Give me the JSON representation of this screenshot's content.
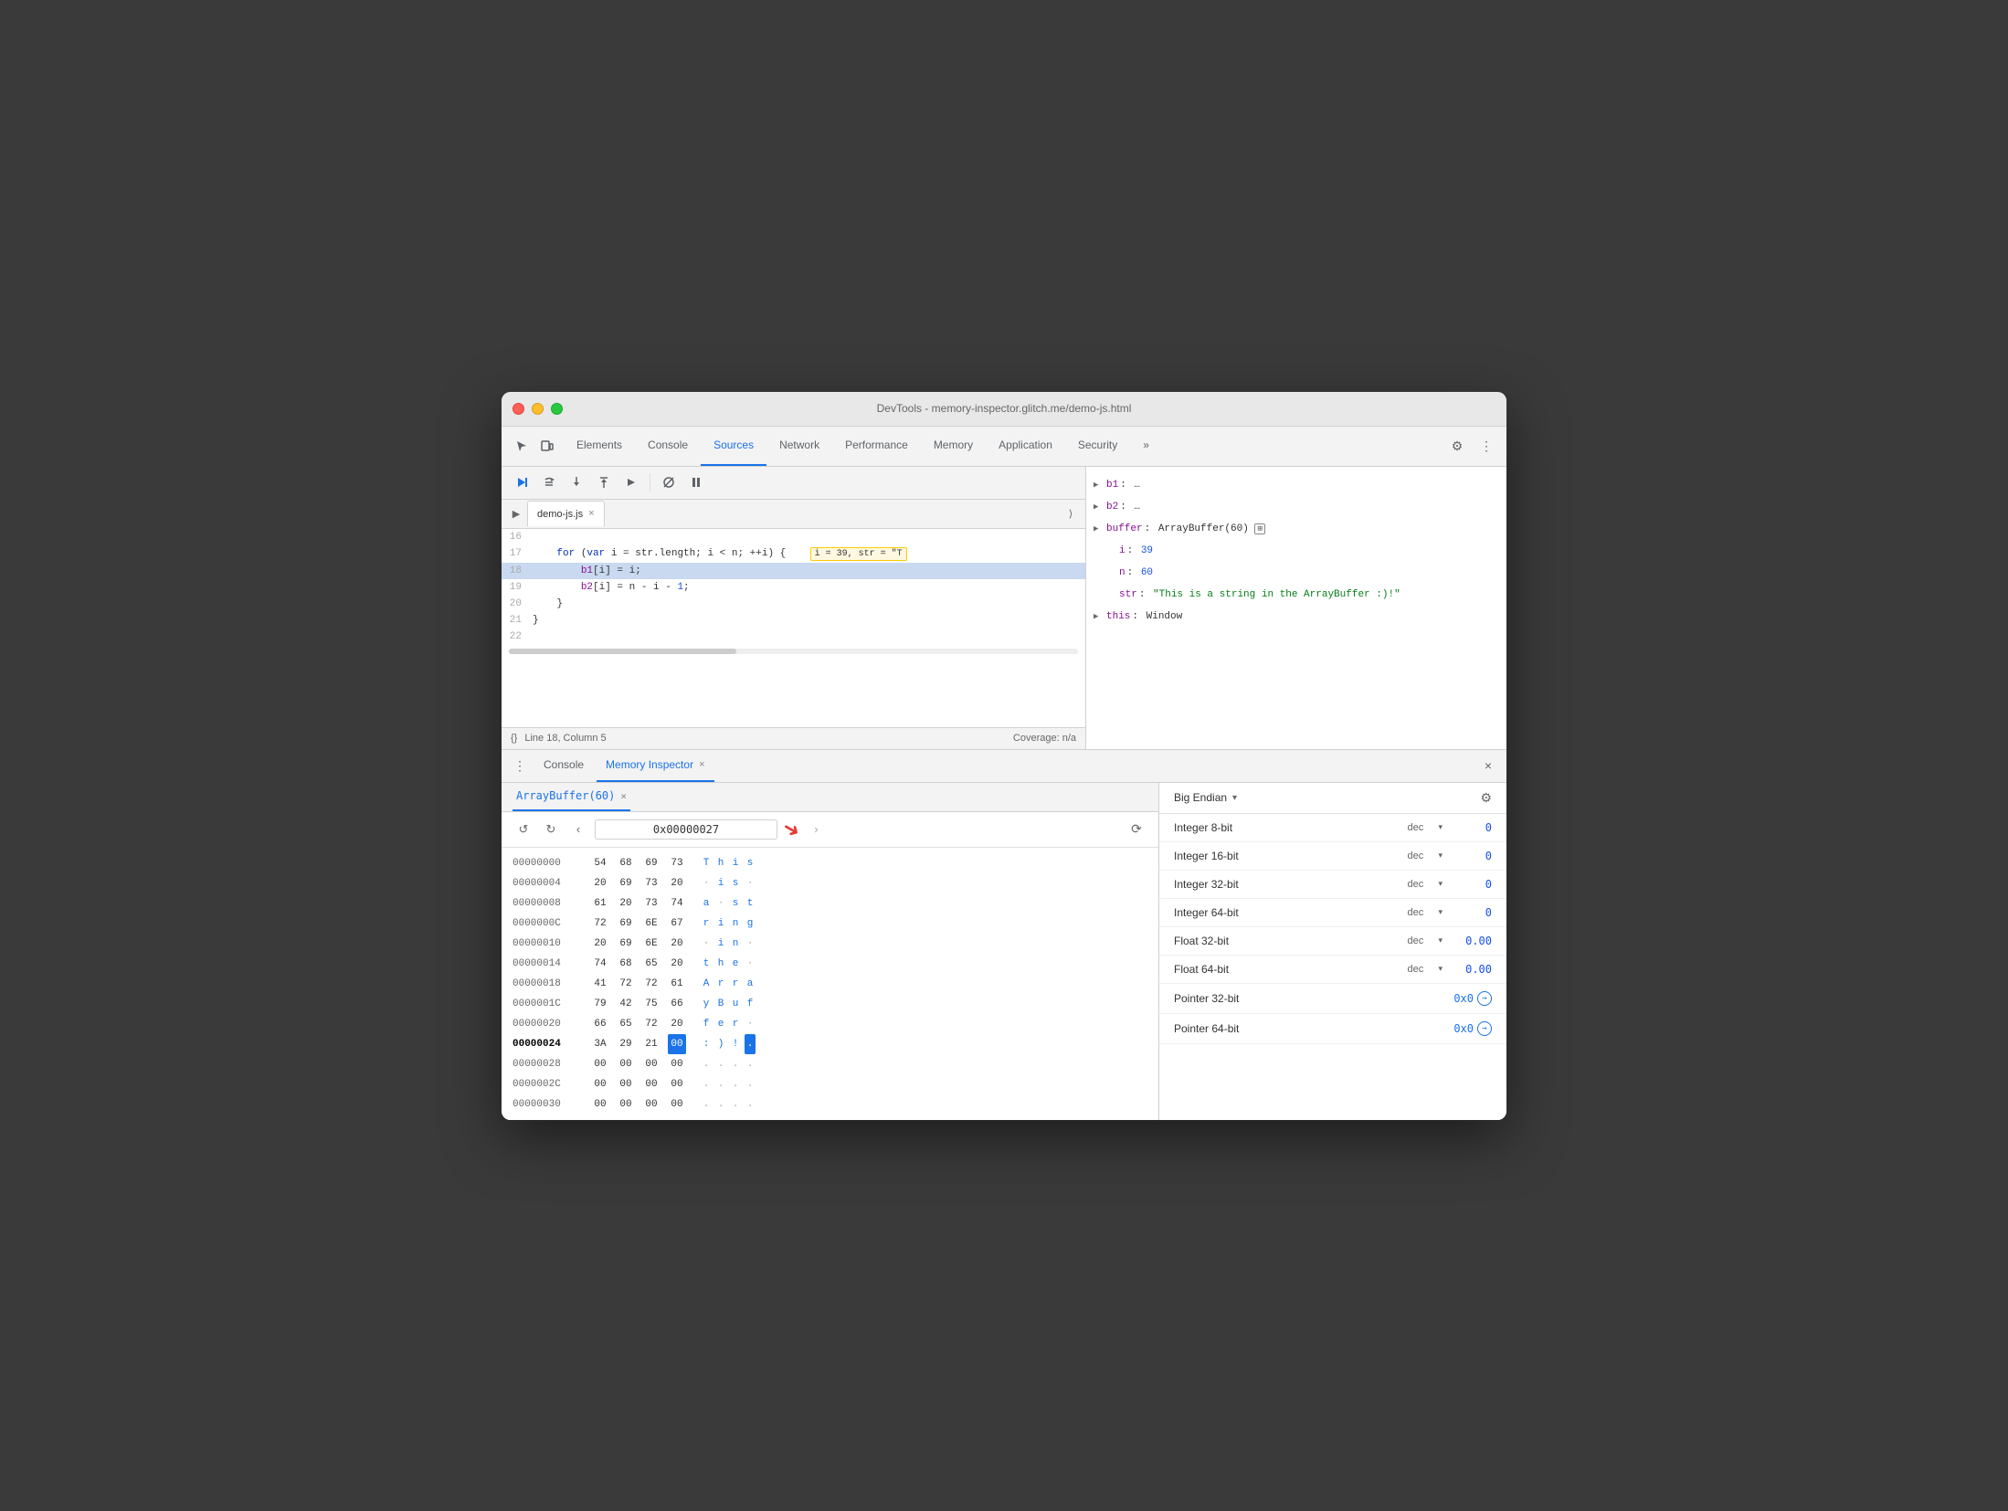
{
  "window": {
    "title": "DevTools - memory-inspector.glitch.me/demo-js.html"
  },
  "tabs": {
    "items": [
      "Elements",
      "Console",
      "Sources",
      "Network",
      "Performance",
      "Memory",
      "Application",
      "Security"
    ]
  },
  "active_tab": "Sources",
  "editor": {
    "filename": "demo-js.js",
    "lines": [
      {
        "num": 16,
        "content": ""
      },
      {
        "num": 17,
        "content": "    for (var i = str.length; i < n; ++i) {",
        "tooltip": "i = 39, str = \"T"
      },
      {
        "num": 18,
        "content": "        b1[i] = i;",
        "highlighted": true
      },
      {
        "num": 19,
        "content": "        b2[i] = n - i - 1;"
      },
      {
        "num": 20,
        "content": "    }"
      },
      {
        "num": 21,
        "content": "}"
      },
      {
        "num": 22,
        "content": ""
      }
    ],
    "status": {
      "left": "Line 18, Column 5",
      "right": "Coverage: n/a"
    }
  },
  "scope": {
    "items": [
      {
        "key": "b1",
        "sep": ":",
        "val": "…"
      },
      {
        "key": "b2",
        "sep": ":",
        "val": "…"
      },
      {
        "key": "buffer",
        "sep": ":",
        "val": "ArrayBuffer(60) 🔲"
      },
      {
        "key": "i",
        "sep": ":",
        "val": "39"
      },
      {
        "key": "n",
        "sep": ":",
        "val": "60"
      },
      {
        "key": "str",
        "sep": ":",
        "val": "\"This is a string in the ArrayBuffer :)!\""
      },
      {
        "key": "this",
        "sep": ":",
        "val": "Window"
      }
    ]
  },
  "bottom_tabs": {
    "items": [
      "Console",
      "Memory Inspector"
    ]
  },
  "active_bottom_tab": "Memory Inspector",
  "array_buffer_tab": {
    "label": "ArrayBuffer(60)"
  },
  "hex_toolbar": {
    "address": "0x00000027",
    "back_label": "‹",
    "forward_label": "›",
    "prev_label": "◂",
    "next_label": "▸",
    "refresh_label": "↻"
  },
  "hex_rows": [
    {
      "addr": "00000000",
      "bytes": [
        "54",
        "68",
        "69",
        "73"
      ],
      "chars": [
        "T",
        "h",
        "i",
        "s"
      ],
      "selected": false
    },
    {
      "addr": "00000004",
      "bytes": [
        "20",
        "69",
        "73",
        "20"
      ],
      "chars": [
        " ",
        "i",
        "s",
        " "
      ],
      "selected": false
    },
    {
      "addr": "00000008",
      "bytes": [
        "61",
        "20",
        "73",
        "74"
      ],
      "chars": [
        "a",
        " ",
        "s",
        "t"
      ],
      "selected": false
    },
    {
      "addr": "0000000C",
      "bytes": [
        "72",
        "69",
        "6E",
        "67"
      ],
      "chars": [
        "r",
        "i",
        "n",
        "g"
      ],
      "selected": false
    },
    {
      "addr": "00000010",
      "bytes": [
        "20",
        "69",
        "6E",
        "20"
      ],
      "chars": [
        " ",
        "i",
        "n",
        " "
      ],
      "selected": false
    },
    {
      "addr": "00000014",
      "bytes": [
        "74",
        "68",
        "65",
        "20"
      ],
      "chars": [
        "t",
        "h",
        "e",
        " "
      ],
      "selected": false
    },
    {
      "addr": "00000018",
      "bytes": [
        "41",
        "72",
        "72",
        "61"
      ],
      "chars": [
        "A",
        "r",
        "r",
        "a"
      ],
      "selected": false
    },
    {
      "addr": "0000001C",
      "bytes": [
        "79",
        "42",
        "75",
        "66"
      ],
      "chars": [
        "y",
        "B",
        "u",
        "f"
      ],
      "selected": false
    },
    {
      "addr": "00000020",
      "bytes": [
        "66",
        "65",
        "72",
        "20"
      ],
      "chars": [
        "f",
        "e",
        "r",
        " "
      ],
      "selected": false
    },
    {
      "addr": "00000024",
      "bytes": [
        "3A",
        "29",
        "21",
        "00"
      ],
      "chars": [
        ":",
        ")",
        "!",
        "."
      ],
      "selected": true,
      "selected_byte": 3
    },
    {
      "addr": "00000028",
      "bytes": [
        "00",
        "00",
        "00",
        "00"
      ],
      "chars": [
        ".",
        ".",
        ".",
        "."
      ],
      "selected": false
    },
    {
      "addr": "0000002C",
      "bytes": [
        "00",
        "00",
        "00",
        "00"
      ],
      "chars": [
        ".",
        ".",
        ".",
        "."
      ],
      "selected": false
    },
    {
      "addr": "00000030",
      "bytes": [
        "00",
        "00",
        "00",
        "00"
      ],
      "chars": [
        ".",
        ".",
        ".",
        "."
      ],
      "selected": false
    }
  ],
  "inspector": {
    "endian": "Big Endian",
    "rows": [
      {
        "label": "Integer 8-bit",
        "format": "dec",
        "value": "0"
      },
      {
        "label": "Integer 16-bit",
        "format": "dec",
        "value": "0"
      },
      {
        "label": "Integer 32-bit",
        "format": "dec",
        "value": "0"
      },
      {
        "label": "Integer 64-bit",
        "format": "dec",
        "value": "0"
      },
      {
        "label": "Float 32-bit",
        "format": "dec",
        "value": "0.00"
      },
      {
        "label": "Float 64-bit",
        "format": "dec",
        "value": "0.00"
      },
      {
        "label": "Pointer 32-bit",
        "format": "",
        "value": "0x0",
        "link": true
      },
      {
        "label": "Pointer 64-bit",
        "format": "",
        "value": "0x0",
        "link": true
      }
    ]
  }
}
